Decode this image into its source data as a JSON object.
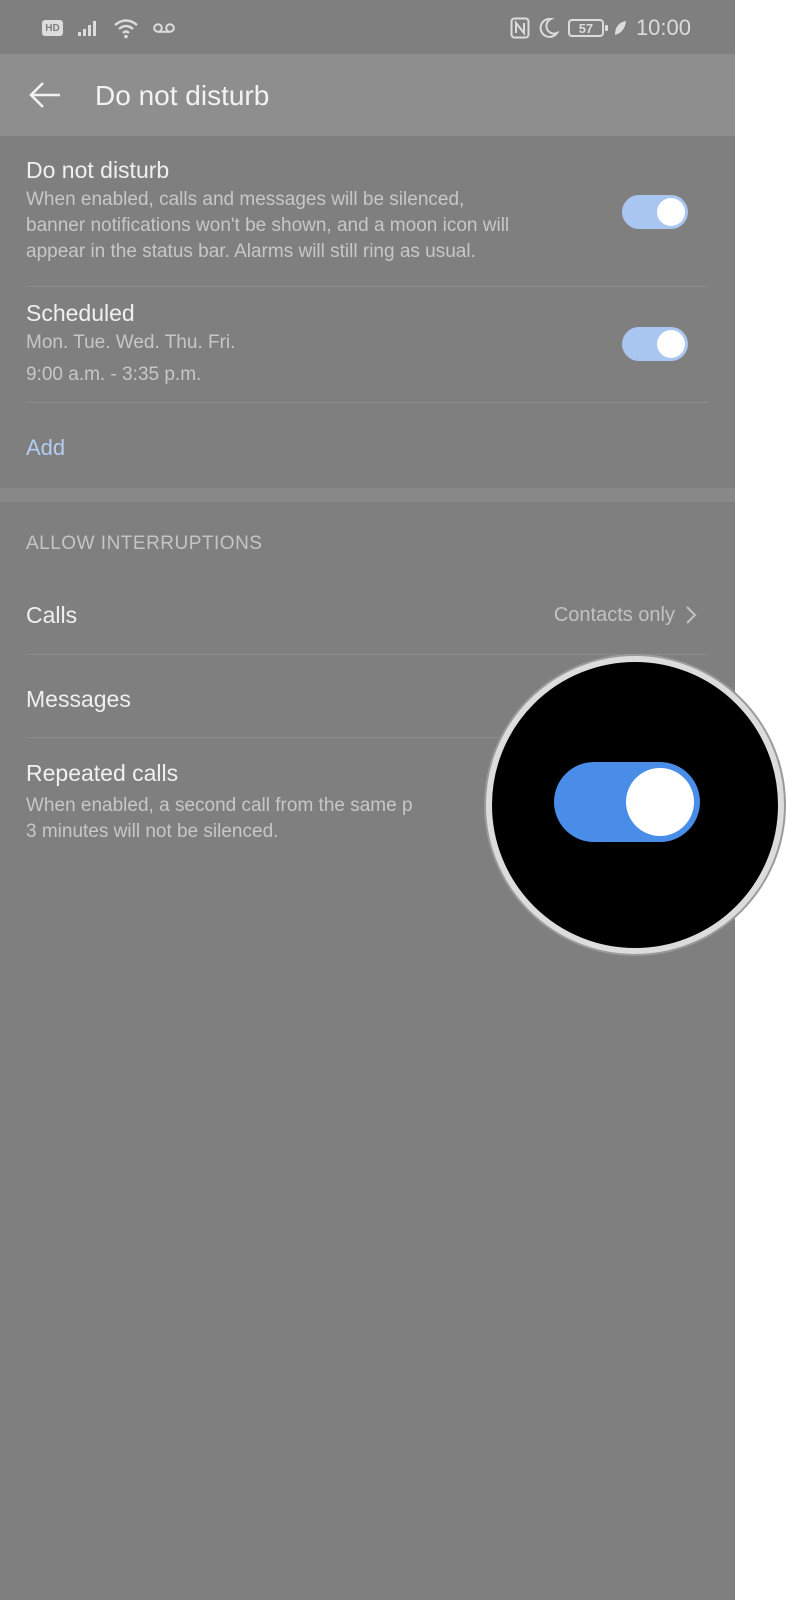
{
  "status_bar": {
    "hd_label": "HD",
    "battery_level": "57",
    "time": "10:00",
    "icons": [
      "hd-icon",
      "signal-icon",
      "wifi-icon",
      "voicemail-icon",
      "nfc-icon",
      "moon-icon",
      "battery-icon",
      "leaf-icon"
    ]
  },
  "toolbar": {
    "title": "Do not disturb",
    "back_icon": "back-arrow-icon"
  },
  "dnd": {
    "title": "Do not disturb",
    "description_line1": "When enabled, calls and messages will be silenced,",
    "description_line2": "banner notifications won't be shown, and a moon icon will",
    "description_line3": "appear in the status bar. Alarms will still ring as usual.",
    "enabled": true
  },
  "scheduled": {
    "title": "Scheduled",
    "days": "Mon. Tue. Wed. Thu. Fri.",
    "time_range": "9:00 a.m. - 3:35 p.m.",
    "enabled": true
  },
  "add_label": "Add",
  "allow_interruptions": {
    "header": "ALLOW INTERRUPTIONS",
    "calls_label": "Calls",
    "calls_value": "Contacts only",
    "messages_label": "Messages",
    "repeated_calls_label": "Repeated calls",
    "repeated_calls_desc_line1": "When enabled, a second call from the same p",
    "repeated_calls_desc_line2": "3 minutes will not be silenced.",
    "repeated_calls_enabled": true
  },
  "colors": {
    "screen_bg": "#7f7f7f",
    "toolbar_bg": "#8e8e8e",
    "toggle_on": "#a9c6f0",
    "toggle_on_magnified": "#4a8de8",
    "link": "#b3cdf2"
  }
}
